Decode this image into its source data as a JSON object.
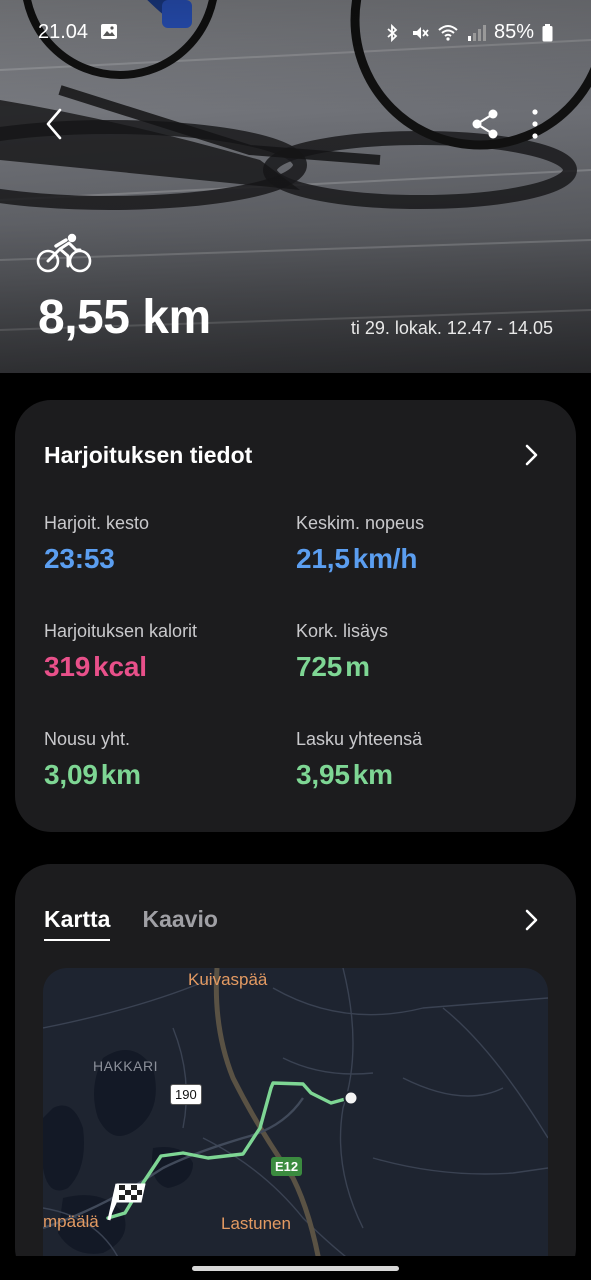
{
  "status_bar": {
    "time": "21.04",
    "battery": "85%",
    "icons": [
      "image-icon",
      "bluetooth-icon",
      "mute-icon",
      "wifi-icon",
      "signal-icon",
      "battery-icon"
    ]
  },
  "header": {
    "back_icon": "back-arrow-icon",
    "share_icon": "share-icon",
    "more_icon": "more-vertical-icon",
    "activity_icon": "bicycle-icon",
    "distance": "8,55 km",
    "datetime": "ti 29. lokak. 12.47 - 14.05"
  },
  "workout_card": {
    "title": "Harjoituksen tiedot",
    "metrics": [
      {
        "label": "Harjoit. kesto",
        "value": "23:53",
        "unit": "",
        "color": "#5b9ef0"
      },
      {
        "label": "Keskim. nopeus",
        "value": "21,5",
        "unit": "km/h",
        "color": "#5b9ef0"
      },
      {
        "label": "Harjoituksen kalorit",
        "value": "319",
        "unit": "kcal",
        "color": "#e8508a"
      },
      {
        "label": "Kork. lisäys",
        "value": "725",
        "unit": "m",
        "color": "#7ed694"
      },
      {
        "label": "Nousu yht.",
        "value": "3,09",
        "unit": "km",
        "color": "#7ed694"
      },
      {
        "label": "Lasku yhteensä",
        "value": "3,95",
        "unit": "km",
        "color": "#7ed694"
      }
    ]
  },
  "map_card": {
    "tabs": [
      {
        "label": "Kartta",
        "active": true
      },
      {
        "label": "Kaavio",
        "active": false
      }
    ],
    "map": {
      "labels": [
        "Kuivaspää",
        "HAKKARI",
        "Lastunen",
        "mpäälä"
      ],
      "road_badges": [
        "190",
        "E12"
      ],
      "route_color": "#7ed694"
    }
  }
}
